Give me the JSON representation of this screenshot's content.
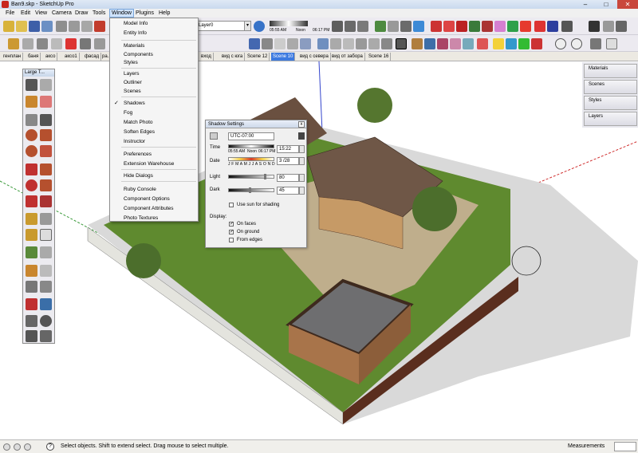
{
  "window": {
    "title": "Ban9.skp - SketchUp Pro",
    "min": "–",
    "max": "□",
    "close": "✕"
  },
  "menubar": [
    "File",
    "Edit",
    "View",
    "Camera",
    "Draw",
    "Tools",
    "Window",
    "Plugins",
    "Help"
  ],
  "active_menu": "Window",
  "toolbar": {
    "layer": "Layer0",
    "dropdown_arrow": "▾",
    "time_am": "05:55 AM",
    "time_noon": "Noon",
    "time_pm": "06:17 PM"
  },
  "scenes": [
    "генплан",
    "баня",
    "аксо",
    "аксо1",
    "фасад",
    "ра...",
    "вход",
    "вид с юга",
    "Scene 12",
    "Scene 10",
    "вид с севера",
    "вид от забора",
    "Scene 16"
  ],
  "selected_scene": "Scene 10",
  "left_toolbar_title": "Large T...",
  "window_menu": {
    "items": [
      {
        "label": "Model Info",
        "checked": false
      },
      {
        "label": "Entity Info",
        "checked": false
      },
      {
        "label": "Materials",
        "checked": false
      },
      {
        "label": "Components",
        "checked": false
      },
      {
        "label": "Styles",
        "checked": false
      },
      {
        "label": "Layers",
        "checked": false
      },
      {
        "label": "Outliner",
        "checked": false
      },
      {
        "label": "Scenes",
        "checked": false
      },
      {
        "label": "Shadows",
        "checked": true
      },
      {
        "label": "Fog",
        "checked": false
      },
      {
        "label": "Match Photo",
        "checked": false
      },
      {
        "label": "Soften Edges",
        "checked": false
      },
      {
        "label": "Instructor",
        "checked": false
      },
      {
        "label": "Preferences",
        "checked": false
      },
      {
        "label": "Extension Warehouse",
        "checked": false
      },
      {
        "label": "Hide Dialogs",
        "checked": false
      },
      {
        "label": "Ruby Console",
        "checked": false
      },
      {
        "label": "Component Options",
        "checked": false
      },
      {
        "label": "Component Attributes",
        "checked": false
      },
      {
        "label": "Photo Textures",
        "checked": false
      }
    ],
    "check_glyph": "✓"
  },
  "shadow_settings": {
    "title": "Shadow Settings",
    "close": "x",
    "timezone": "UTC-07:00",
    "time_label": "Time",
    "time_am": "05:55 AM",
    "time_noon": "Noon",
    "time_pm": "06:17 PM",
    "time_value": "15:22",
    "time_fraction": 0.78,
    "date_label": "Date",
    "months": "J F M A M J J A S O N D",
    "date_value": "3 /28",
    "date_fraction": 0.23,
    "light_label": "Light",
    "light_value": "80",
    "light_fraction": 0.8,
    "dark_label": "Dark",
    "dark_value": "45",
    "dark_fraction": 0.45,
    "use_sun_label": "Use sun for shading",
    "use_sun": false,
    "display_label": "Display:",
    "on_faces_label": "On faces",
    "on_faces": true,
    "on_ground_label": "On ground",
    "on_ground": true,
    "from_edges_label": "From edges",
    "from_edges": false
  },
  "right_panel": [
    "Materials",
    "Scenes",
    "Styles",
    "Layers"
  ],
  "status": {
    "text": "Select objects. Shift to extend select. Drag mouse to select multiple.",
    "measurements_label": "Measurements"
  }
}
